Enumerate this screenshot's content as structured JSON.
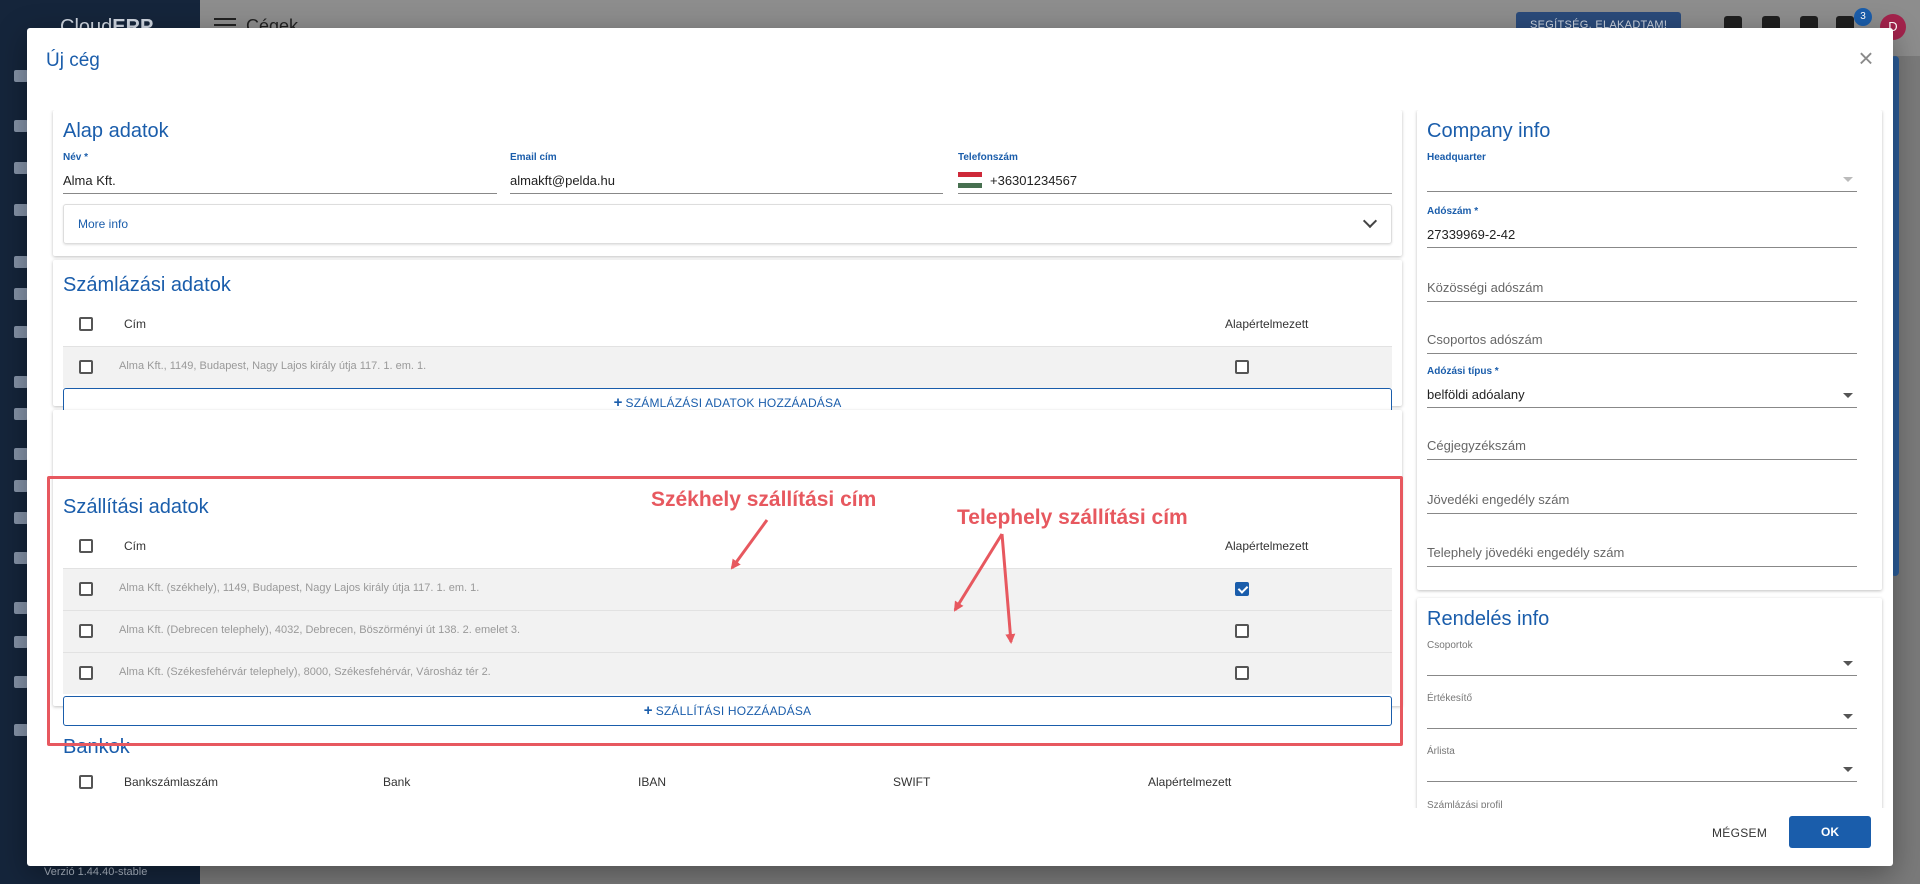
{
  "app": {
    "logo_prefix": "Cloud",
    "logo_suffix": "ERP",
    "page_title": "Cégek",
    "help_button": "SEGÍTSÉG, ELAKADTAM!",
    "notification_count": "3",
    "user_initial": "D",
    "version": "Verzió 1.44.40-stable"
  },
  "dialog": {
    "title": "Új cég",
    "close_symbol": "×",
    "cancel_label": "MÉGSEM",
    "ok_label": "OK"
  },
  "basic": {
    "title": "Alap adatok",
    "name_label": "Név *",
    "name_value": "Alma Kft.",
    "email_label": "Email cím",
    "email_value": "almakft@pelda.hu",
    "phone_label": "Telefonszám",
    "phone_value": "+36301234567",
    "more_info": "More info"
  },
  "billing": {
    "title": "Számlázási adatok",
    "col_address": "Cím",
    "col_default": "Alapértelmezett",
    "rows": [
      {
        "address": "Alma Kft., 1149, Budapest, Nagy Lajos király útja 117.  1. em. 1.",
        "default": false
      }
    ],
    "add_button": "SZÁMLÁZÁSI ADATOK HOZZÁADÁSA"
  },
  "shipping": {
    "title": "Szállítási adatok",
    "col_address": "Cím",
    "col_default": "Alapértelmezett",
    "rows": [
      {
        "address": "Alma Kft. (székhely), 1149, Budapest, Nagy Lajos király útja 117.  1. em. 1.",
        "default": true
      },
      {
        "address": "Alma Kft. (Debrecen telephely), 4032, Debrecen, Böszörményi út 138. 2. emelet 3.",
        "default": false
      },
      {
        "address": "Alma Kft. (Székesfehérvár telephely), 8000, Székesfehérvár, Városház tér 2.",
        "default": false
      }
    ],
    "add_button": "SZÁLLÍTÁSI HOZZÁADÁSA"
  },
  "annotations": {
    "headquarters": "Székhely szállítási cím",
    "site": "Telephely szállítási cím"
  },
  "banks": {
    "title": "Bankok",
    "columns": [
      "Bankszámlaszám",
      "Bank",
      "IBAN",
      "SWIFT",
      "Alapértelmezett"
    ]
  },
  "company_info": {
    "title": "Company info",
    "headquarter_label": "Headquarter",
    "tax_number_label": "Adószám *",
    "tax_number_value": "27339969-2-42",
    "community_tax_placeholder": "Közösségi adószám",
    "group_tax_placeholder": "Csoportos adószám",
    "tax_type_label": "Adózási típus *",
    "tax_type_value": "belföldi adóalany",
    "company_reg_placeholder": "Cégjegyzékszám",
    "excise_placeholder": "Jövedéki engedély szám",
    "site_excise_placeholder": "Telephely jövedéki engedély szám"
  },
  "order_info": {
    "title": "Rendelés info",
    "groups_label": "Csoportok",
    "salesperson_label": "Értékesítő",
    "pricelist_label": "Árlista",
    "billing_profile_label": "Számlázási profil"
  },
  "colors": {
    "accent": "#1a5dab",
    "annotation": "#e7585f"
  }
}
